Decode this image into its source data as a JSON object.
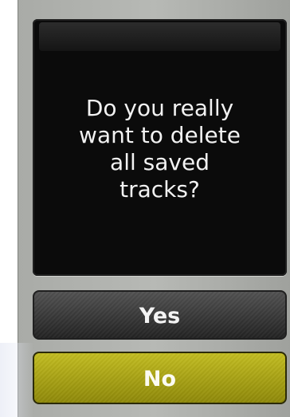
{
  "dialog": {
    "message": "Do you really\nwant to delete\nall saved\ntracks?"
  },
  "buttons": {
    "yes": "Yes",
    "no": "No"
  },
  "colors": {
    "dialog_background": "#0b0b0b",
    "screen_background": "#b0b2ae",
    "yes_button": "#3a3a3a",
    "no_button": "#aba514",
    "text": "#f4f4f4"
  }
}
